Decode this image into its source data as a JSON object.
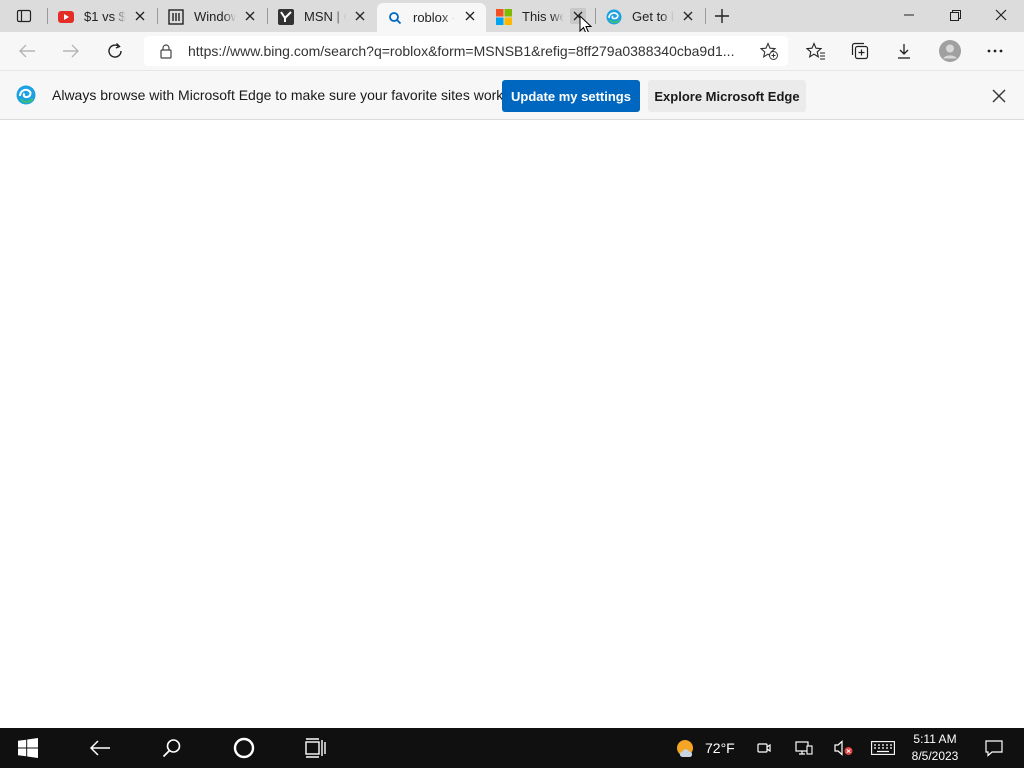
{
  "tabs": [
    {
      "title": "$1 vs $1",
      "favicon": "youtube-icon",
      "state": "normal"
    },
    {
      "title": "Window",
      "favicon": "museum-icon",
      "state": "normal"
    },
    {
      "title": "MSN | C",
      "favicon": "yahoo-icon",
      "state": "normal"
    },
    {
      "title": "roblox -",
      "favicon": "bing-search-icon",
      "state": "active"
    },
    {
      "title": "This we",
      "favicon": "microsoft-logo-icon",
      "state": "hover"
    },
    {
      "title": "Get to k",
      "favicon": "edge-icon",
      "state": "normal"
    }
  ],
  "address_bar": {
    "url": "https://www.bing.com/search?q=roblox&form=MSNSB1&refig=8ff279a0388340cba9d1..."
  },
  "infobar": {
    "message": "Always browse with Microsoft Edge to make sure your favorite sites work",
    "primary_label": "Update my settings",
    "secondary_label": "Explore Microsoft Edge"
  },
  "taskbar": {
    "temperature": "72°F",
    "time": "5:11 AM",
    "date": "8/5/2023"
  },
  "colors": {
    "accent": "#0067c0",
    "taskbar": "#101010",
    "tabstrip": "#dcdcdc"
  }
}
